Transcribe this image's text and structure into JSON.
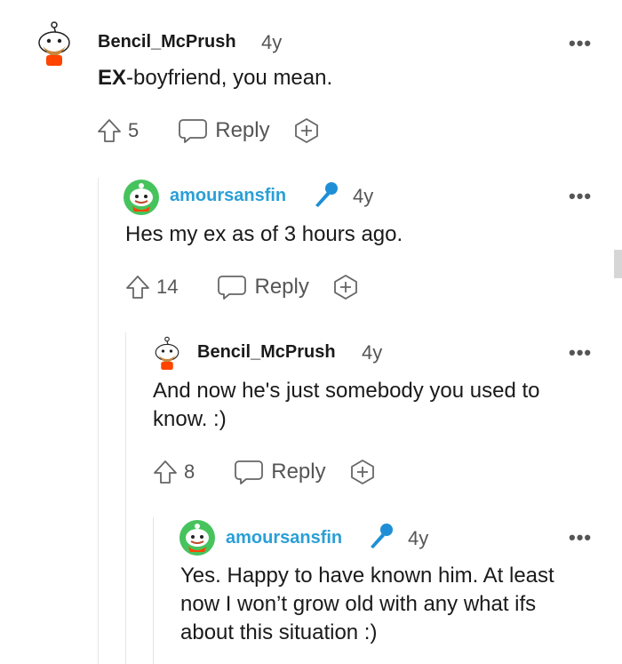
{
  "comments": [
    {
      "username": "Bencil_McPrush",
      "time": "4y",
      "body_strong": "EX",
      "body_rest": "-boyfriend, you mean.",
      "votes": "5",
      "reply_label": "Reply",
      "avatar": "snoo-bearded-avatar"
    },
    {
      "username": "amoursansfin",
      "time": "4y",
      "body": "Hes my ex as of 3 hours ago.",
      "votes": "14",
      "reply_label": "Reply",
      "avatar": "snoo-green-avatar",
      "flair_icon": "microphone-icon"
    },
    {
      "username": "Bencil_McPrush",
      "time": "4y",
      "body": "And now he's just somebody you used to know. :)",
      "votes": "8",
      "reply_label": "Reply",
      "avatar": "snoo-bearded-avatar"
    },
    {
      "username": "amoursansfin",
      "time": "4y",
      "body": "Yes. Happy to have known him. At least now I won’t grow old with any what ifs about this situation :)",
      "avatar": "snoo-green-avatar",
      "flair_icon": "microphone-icon"
    }
  ],
  "more_label": "•••",
  "colors": {
    "link_blue": "#2a9fd6",
    "mic_blue": "#1e8fd6",
    "avatar_green": "#46c35d",
    "avatar_orange": "#ff4500",
    "thread_line": "#e5e5e5"
  }
}
